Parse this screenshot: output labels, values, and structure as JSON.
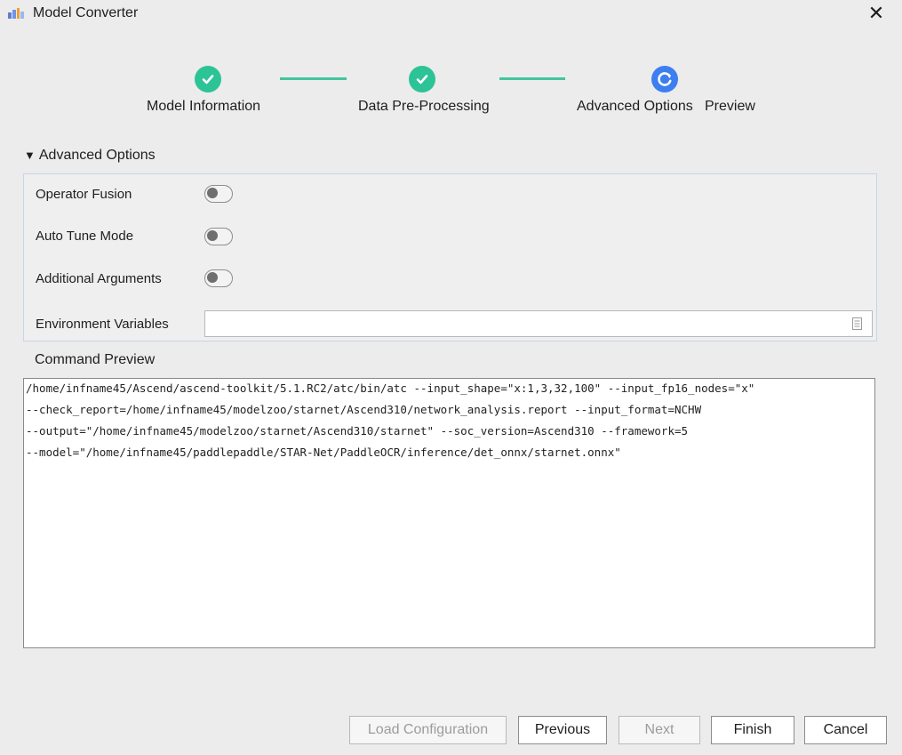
{
  "window": {
    "title": "Model Converter",
    "close_glyph": "✕",
    "app_icon": "app-logo-icon"
  },
  "stepper": {
    "steps": [
      {
        "label": "Model Information",
        "status": "completed",
        "icon": "checkmark-icon"
      },
      {
        "label": "Data Pre-Processing",
        "status": "completed",
        "icon": "checkmark-icon"
      },
      {
        "label": "Advanced Options",
        "status": "in-progress",
        "icon": "refresh-icon"
      },
      {
        "label": "Preview",
        "status": "pending"
      }
    ],
    "colors": {
      "completed": "#2cc397",
      "active": "#3d7ff0",
      "connector": "#42c59e"
    }
  },
  "advanced": {
    "header": "Advanced Options",
    "caret": "▼",
    "options": [
      {
        "label": "Operator Fusion",
        "enabled": false
      },
      {
        "label": "Auto Tune Mode",
        "enabled": false
      },
      {
        "label": "Additional Arguments",
        "enabled": false
      }
    ],
    "env_label": "Environment Variables",
    "env_value": ""
  },
  "preview": {
    "label": "Command Preview",
    "lines": [
      "/home/infname45/Ascend/ascend-toolkit/5.1.RC2/atc/bin/atc  --input_shape=\"x:1,3,32,100\" --input_fp16_nodes=\"x\"",
      "--check_report=/home/infname45/modelzoo/starnet/Ascend310/network_analysis.report --input_format=NCHW",
      "--output=\"/home/infname45/modelzoo/starnet/Ascend310/starnet\" --soc_version=Ascend310 --framework=5",
      "--model=\"/home/infname45/paddlepaddle/STAR-Net/PaddleOCR/inference/det_onnx/starnet.onnx\""
    ]
  },
  "footer": {
    "load_config": "Load Configuration",
    "previous": "Previous",
    "next": "Next",
    "finish": "Finish",
    "cancel": "Cancel"
  }
}
